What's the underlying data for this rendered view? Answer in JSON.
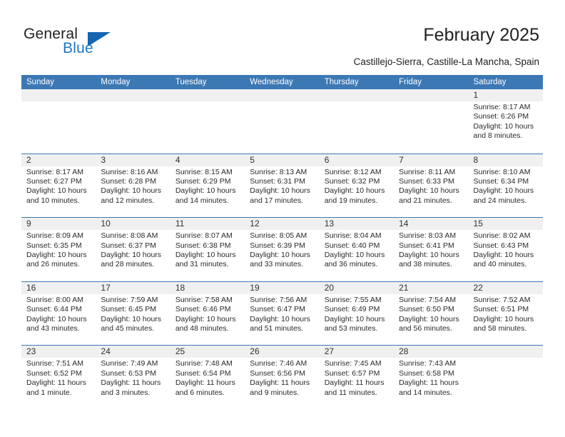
{
  "brand": {
    "name_part1": "General",
    "name_part2": "Blue",
    "logo_icon": "triangle-flag-icon",
    "accent_color": "#1565b0"
  },
  "header": {
    "title": "February 2025",
    "location": "Castillejo-Sierra, Castille-La Mancha, Spain"
  },
  "calendar": {
    "header_bg": "#3c78b4",
    "band_bg": "#f0f0f0",
    "weekday_names": [
      "Sunday",
      "Monday",
      "Tuesday",
      "Wednesday",
      "Thursday",
      "Friday",
      "Saturday"
    ],
    "weeks": [
      [
        {
          "day": "",
          "lines": []
        },
        {
          "day": "",
          "lines": []
        },
        {
          "day": "",
          "lines": []
        },
        {
          "day": "",
          "lines": []
        },
        {
          "day": "",
          "lines": []
        },
        {
          "day": "",
          "lines": []
        },
        {
          "day": "1",
          "lines": [
            "Sunrise: 8:17 AM",
            "Sunset: 6:26 PM",
            "Daylight: 10 hours",
            "and 8 minutes."
          ]
        }
      ],
      [
        {
          "day": "2",
          "lines": [
            "Sunrise: 8:17 AM",
            "Sunset: 6:27 PM",
            "Daylight: 10 hours",
            "and 10 minutes."
          ]
        },
        {
          "day": "3",
          "lines": [
            "Sunrise: 8:16 AM",
            "Sunset: 6:28 PM",
            "Daylight: 10 hours",
            "and 12 minutes."
          ]
        },
        {
          "day": "4",
          "lines": [
            "Sunrise: 8:15 AM",
            "Sunset: 6:29 PM",
            "Daylight: 10 hours",
            "and 14 minutes."
          ]
        },
        {
          "day": "5",
          "lines": [
            "Sunrise: 8:13 AM",
            "Sunset: 6:31 PM",
            "Daylight: 10 hours",
            "and 17 minutes."
          ]
        },
        {
          "day": "6",
          "lines": [
            "Sunrise: 8:12 AM",
            "Sunset: 6:32 PM",
            "Daylight: 10 hours",
            "and 19 minutes."
          ]
        },
        {
          "day": "7",
          "lines": [
            "Sunrise: 8:11 AM",
            "Sunset: 6:33 PM",
            "Daylight: 10 hours",
            "and 21 minutes."
          ]
        },
        {
          "day": "8",
          "lines": [
            "Sunrise: 8:10 AM",
            "Sunset: 6:34 PM",
            "Daylight: 10 hours",
            "and 24 minutes."
          ]
        }
      ],
      [
        {
          "day": "9",
          "lines": [
            "Sunrise: 8:09 AM",
            "Sunset: 6:35 PM",
            "Daylight: 10 hours",
            "and 26 minutes."
          ]
        },
        {
          "day": "10",
          "lines": [
            "Sunrise: 8:08 AM",
            "Sunset: 6:37 PM",
            "Daylight: 10 hours",
            "and 28 minutes."
          ]
        },
        {
          "day": "11",
          "lines": [
            "Sunrise: 8:07 AM",
            "Sunset: 6:38 PM",
            "Daylight: 10 hours",
            "and 31 minutes."
          ]
        },
        {
          "day": "12",
          "lines": [
            "Sunrise: 8:05 AM",
            "Sunset: 6:39 PM",
            "Daylight: 10 hours",
            "and 33 minutes."
          ]
        },
        {
          "day": "13",
          "lines": [
            "Sunrise: 8:04 AM",
            "Sunset: 6:40 PM",
            "Daylight: 10 hours",
            "and 36 minutes."
          ]
        },
        {
          "day": "14",
          "lines": [
            "Sunrise: 8:03 AM",
            "Sunset: 6:41 PM",
            "Daylight: 10 hours",
            "and 38 minutes."
          ]
        },
        {
          "day": "15",
          "lines": [
            "Sunrise: 8:02 AM",
            "Sunset: 6:43 PM",
            "Daylight: 10 hours",
            "and 40 minutes."
          ]
        }
      ],
      [
        {
          "day": "16",
          "lines": [
            "Sunrise: 8:00 AM",
            "Sunset: 6:44 PM",
            "Daylight: 10 hours",
            "and 43 minutes."
          ]
        },
        {
          "day": "17",
          "lines": [
            "Sunrise: 7:59 AM",
            "Sunset: 6:45 PM",
            "Daylight: 10 hours",
            "and 45 minutes."
          ]
        },
        {
          "day": "18",
          "lines": [
            "Sunrise: 7:58 AM",
            "Sunset: 6:46 PM",
            "Daylight: 10 hours",
            "and 48 minutes."
          ]
        },
        {
          "day": "19",
          "lines": [
            "Sunrise: 7:56 AM",
            "Sunset: 6:47 PM",
            "Daylight: 10 hours",
            "and 51 minutes."
          ]
        },
        {
          "day": "20",
          "lines": [
            "Sunrise: 7:55 AM",
            "Sunset: 6:49 PM",
            "Daylight: 10 hours",
            "and 53 minutes."
          ]
        },
        {
          "day": "21",
          "lines": [
            "Sunrise: 7:54 AM",
            "Sunset: 6:50 PM",
            "Daylight: 10 hours",
            "and 56 minutes."
          ]
        },
        {
          "day": "22",
          "lines": [
            "Sunrise: 7:52 AM",
            "Sunset: 6:51 PM",
            "Daylight: 10 hours",
            "and 58 minutes."
          ]
        }
      ],
      [
        {
          "day": "23",
          "lines": [
            "Sunrise: 7:51 AM",
            "Sunset: 6:52 PM",
            "Daylight: 11 hours",
            "and 1 minute."
          ]
        },
        {
          "day": "24",
          "lines": [
            "Sunrise: 7:49 AM",
            "Sunset: 6:53 PM",
            "Daylight: 11 hours",
            "and 3 minutes."
          ]
        },
        {
          "day": "25",
          "lines": [
            "Sunrise: 7:48 AM",
            "Sunset: 6:54 PM",
            "Daylight: 11 hours",
            "and 6 minutes."
          ]
        },
        {
          "day": "26",
          "lines": [
            "Sunrise: 7:46 AM",
            "Sunset: 6:56 PM",
            "Daylight: 11 hours",
            "and 9 minutes."
          ]
        },
        {
          "day": "27",
          "lines": [
            "Sunrise: 7:45 AM",
            "Sunset: 6:57 PM",
            "Daylight: 11 hours",
            "and 11 minutes."
          ]
        },
        {
          "day": "28",
          "lines": [
            "Sunrise: 7:43 AM",
            "Sunset: 6:58 PM",
            "Daylight: 11 hours",
            "and 14 minutes."
          ]
        },
        {
          "day": "",
          "lines": []
        }
      ]
    ]
  }
}
